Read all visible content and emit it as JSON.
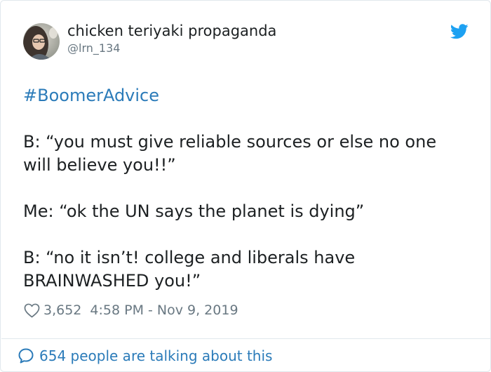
{
  "author": {
    "display_name": "chicken teriyaki propaganda",
    "handle": "@lrn_134",
    "avatar_icon": "user-avatar"
  },
  "tweet": {
    "hashtag": "#BoomerAdvice",
    "lines": [
      "B: “you must give reliable sources or else no one",
      "will believe you!!”",
      "Me: “ok the UN says the planet is dying”",
      "B: “no it isn’t! college and liberals have",
      "BRAINWASHED you!”"
    ]
  },
  "meta": {
    "likes": "3,652",
    "timestamp": "4:58 PM - Nov 9, 2019",
    "heart_icon": "heart-icon"
  },
  "footer": {
    "conversation_text": "654 people are talking about this",
    "bubble_icon": "speech-bubble-icon"
  },
  "brand": {
    "logo_icon": "twitter-bird-icon",
    "accent_color": "#1da1f2",
    "link_color": "#2b7bb9"
  }
}
